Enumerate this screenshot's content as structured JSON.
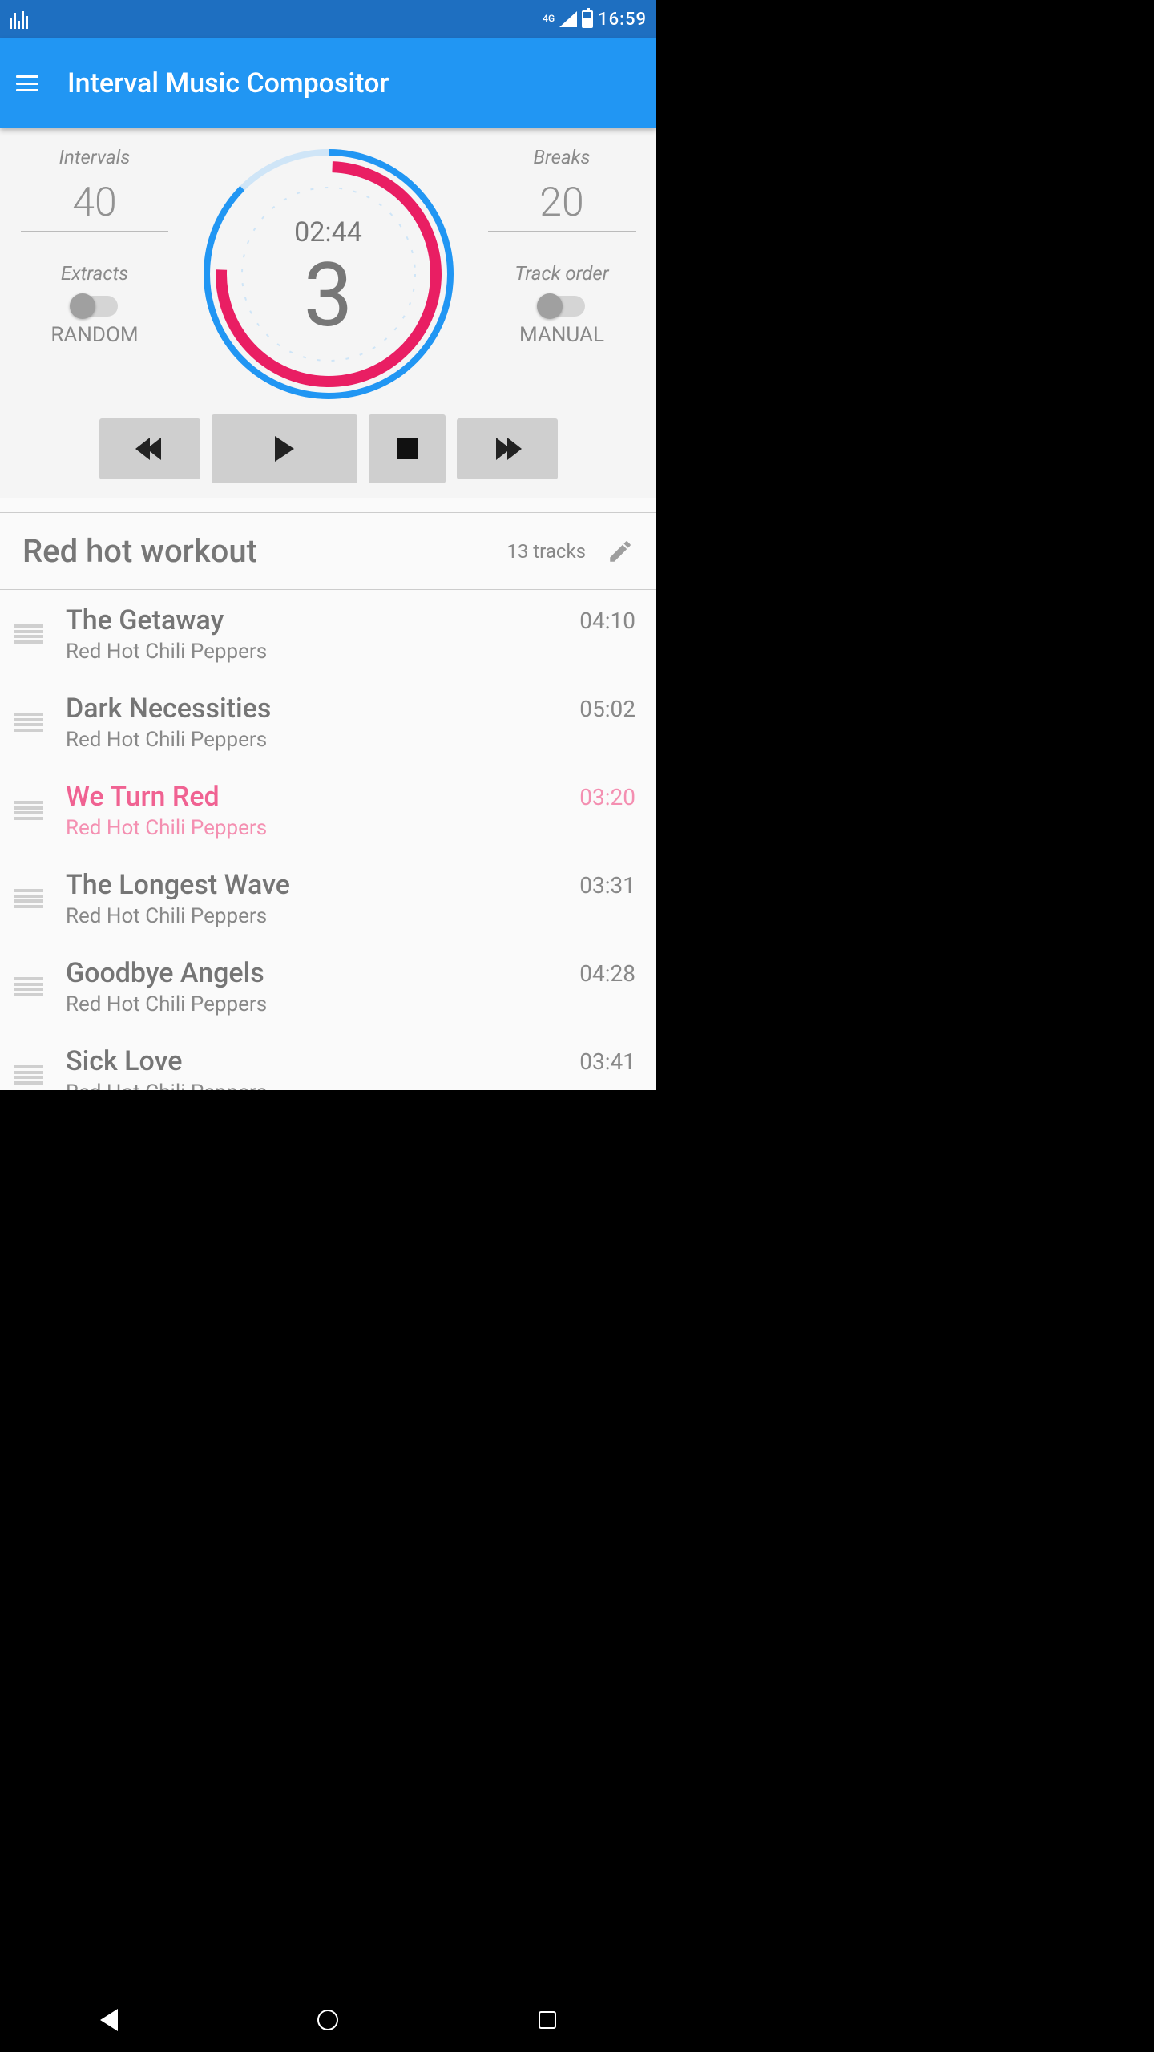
{
  "statusbar": {
    "network": "4G",
    "time": "16:59"
  },
  "appbar": {
    "title": "Interval Music Compositor"
  },
  "intervals": {
    "label": "Intervals",
    "value": "40"
  },
  "breaks": {
    "label": "Breaks",
    "value": "20"
  },
  "extracts": {
    "label": "Extracts",
    "mode": "RANDOM",
    "toggled": false
  },
  "trackorder": {
    "label": "Track order",
    "mode": "MANUAL",
    "toggled": false
  },
  "dial": {
    "time": "02:44",
    "count": "3"
  },
  "playlist": {
    "name": "Red hot workout",
    "track_count_label": "13 tracks",
    "tracks": [
      {
        "title": "The Getaway",
        "artist": "Red Hot Chili Peppers",
        "duration": "04:10",
        "active": false
      },
      {
        "title": "Dark Necessities",
        "artist": "Red Hot Chili Peppers",
        "duration": "05:02",
        "active": false
      },
      {
        "title": "We Turn Red",
        "artist": "Red Hot Chili Peppers",
        "duration": "03:20",
        "active": true
      },
      {
        "title": "The Longest Wave",
        "artist": "Red Hot Chili Peppers",
        "duration": "03:31",
        "active": false
      },
      {
        "title": "Goodbye Angels",
        "artist": "Red Hot Chili Peppers",
        "duration": "04:28",
        "active": false
      },
      {
        "title": "Sick Love",
        "artist": "Red Hot Chili Peppers",
        "duration": "03:41",
        "active": false
      }
    ]
  }
}
